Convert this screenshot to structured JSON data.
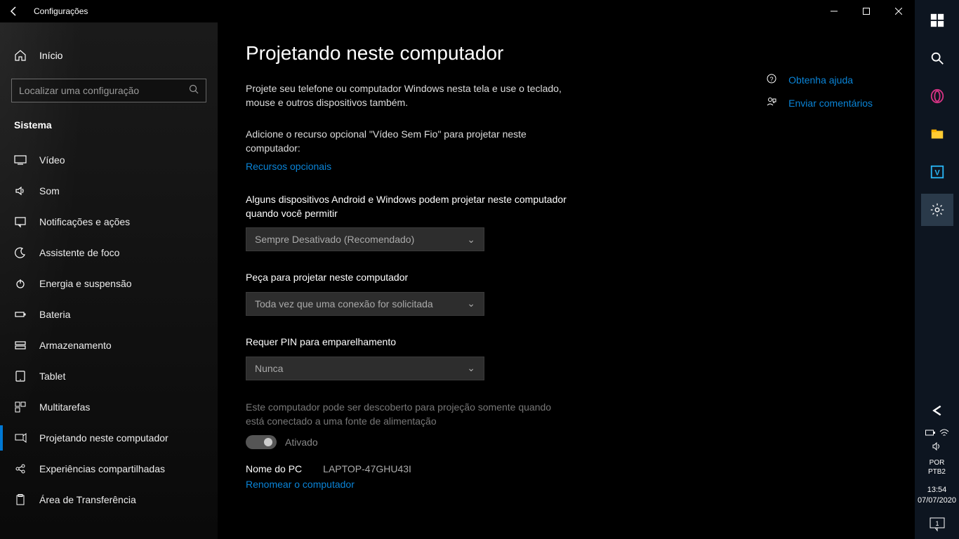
{
  "titlebar": {
    "title": "Configurações"
  },
  "sidebar": {
    "home_label": "Início",
    "search_placeholder": "Localizar uma configuração",
    "section_label": "Sistema",
    "items": [
      {
        "label": "Vídeo"
      },
      {
        "label": "Som"
      },
      {
        "label": "Notificações e ações"
      },
      {
        "label": "Assistente de foco"
      },
      {
        "label": "Energia e suspensão"
      },
      {
        "label": "Bateria"
      },
      {
        "label": "Armazenamento"
      },
      {
        "label": "Tablet"
      },
      {
        "label": "Multitarefas"
      },
      {
        "label": "Projetando neste computador"
      },
      {
        "label": "Experiências compartilhadas"
      },
      {
        "label": "Área de Transferência"
      }
    ]
  },
  "page": {
    "title": "Projetando neste computador",
    "description": "Projete seu telefone ou computador Windows nesta tela e use o teclado, mouse e outros dispositivos também.",
    "optional_note": "Adicione o recurso opcional \"Vídeo Sem Fio\" para projetar neste computador:",
    "optional_link": "Recursos opcionais",
    "setting1_label": "Alguns dispositivos Android e Windows podem projetar neste computador quando você permitir",
    "setting1_value": "Sempre Desativado (Recomendado)",
    "setting2_label": "Peça para projetar neste computador",
    "setting2_value": "Toda vez que uma conexão for solicitada",
    "setting3_label": "Requer PIN para emparelhamento",
    "setting3_value": "Nunca",
    "discover_note": "Este computador pode ser descoberto para projeção somente quando está conectado a uma fonte de alimentação",
    "toggle_label": "Ativado",
    "pcname_label": "Nome do PC",
    "pcname_value": "LAPTOP-47GHU43I",
    "rename_link": "Renomear o computador"
  },
  "help": {
    "get_help": "Obtenha ajuda",
    "feedback": "Enviar comentários"
  },
  "taskbar": {
    "lang1": "POR",
    "lang2": "PTB2",
    "time": "13:54",
    "date": "07/07/2020",
    "notif_count": "1"
  }
}
